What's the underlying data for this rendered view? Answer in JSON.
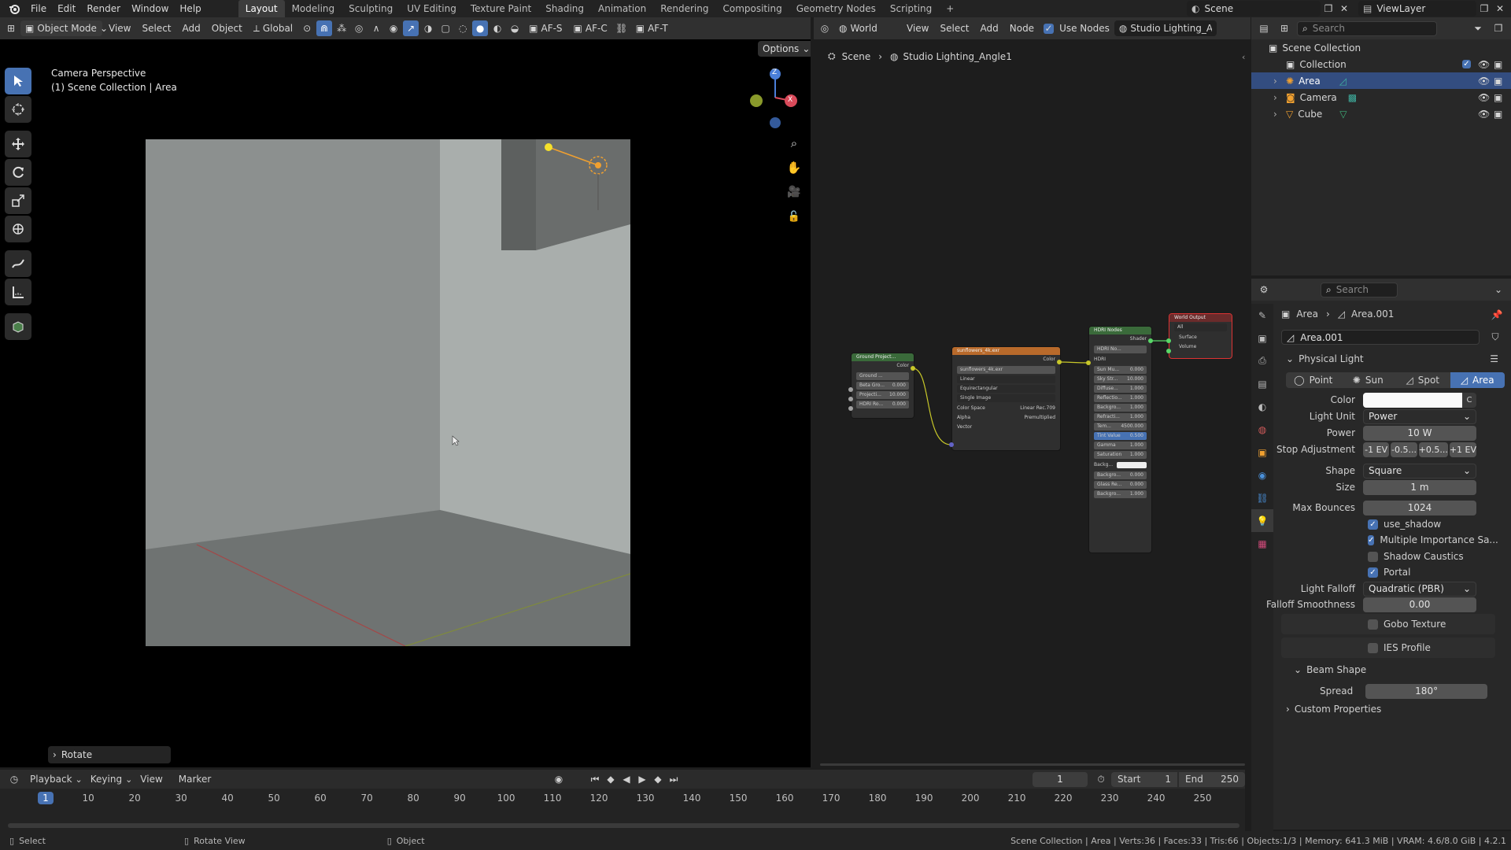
{
  "topbar": {
    "menus": [
      "File",
      "Edit",
      "Render",
      "Window",
      "Help"
    ],
    "workspaces": [
      "Layout",
      "Modeling",
      "Sculpting",
      "UV Editing",
      "Texture Paint",
      "Shading",
      "Animation",
      "Rendering",
      "Compositing",
      "Geometry Nodes",
      "Scripting"
    ],
    "active_workspace": "Layout",
    "scene": "Scene",
    "view_layer": "ViewLayer"
  },
  "viewport_header": {
    "mode": "Object Mode",
    "menus": [
      "View",
      "Select",
      "Add",
      "Object"
    ],
    "orientation": "Global",
    "af_s": "AF-S",
    "af_c": "AF-C",
    "af_t": "AF-T",
    "options": "Options"
  },
  "viewport": {
    "camera_label": "Camera Perspective",
    "collection_label": "(1) Scene Collection | Area",
    "gizmo_x": "X",
    "gizmo_z": "Z",
    "last_op": "Rotate"
  },
  "node_header": {
    "world": "World",
    "menus": [
      "View",
      "Select",
      "Add",
      "Node"
    ],
    "use_nodes": "Use Nodes",
    "world_name": "Studio Lighting_Angle1",
    "breadcrumb_scene": "Scene",
    "breadcrumb_world": "Studio Lighting_Angle1"
  },
  "nodes": {
    "ground": {
      "title": "Ground Project...",
      "color": "Color",
      "field": "Ground ...",
      "rows": [
        [
          "Beta Gro...",
          "0.000"
        ],
        [
          "Projecti...",
          "10.000"
        ],
        [
          "HDRI Ro...",
          "0.000"
        ]
      ]
    },
    "image": {
      "title": "sunflowers_4k.exr",
      "color": "Color",
      "file": "sunflowers_4k.exr",
      "interp": "Linear",
      "proj": "Equirectangular",
      "source": "Single Image",
      "cs_label": "Color Space",
      "cs_value": "Linear Rec.709",
      "alpha_label": "Alpha",
      "alpha_value": "Premultiplied",
      "vector": "Vector"
    },
    "hdri": {
      "title": "HDRI Nodes",
      "shader": "Shader",
      "field": "HDRI No...",
      "hdri": "HDRI",
      "rows": [
        [
          "Sun Mu...",
          "0.000"
        ],
        [
          "Sky Str...",
          "10.000"
        ],
        [
          "Diffuse...",
          "1.000"
        ],
        [
          "Reflectio...",
          "1.000"
        ],
        [
          "Backgro...",
          "1.000"
        ],
        [
          "Refracti...",
          "1.000"
        ],
        [
          "Tem...",
          "4500.000"
        ],
        [
          "Tint Value",
          "0.500"
        ],
        [
          "Gamma",
          "1.000"
        ],
        [
          "Saturation",
          "1.000"
        ]
      ],
      "backg": "Backg...",
      "rows2": [
        [
          "Backgro...",
          "0.000"
        ],
        [
          "Glass Re...",
          "0.000"
        ],
        [
          "Backgro...",
          "1.000"
        ]
      ]
    },
    "output": {
      "title": "World Output",
      "target": "All",
      "surface": "Surface",
      "volume": "Volume"
    }
  },
  "outliner": {
    "search_placeholder": "Search",
    "root": "Scene Collection",
    "collection": "Collection",
    "items": [
      "Area",
      "Camera",
      "Cube"
    ]
  },
  "properties": {
    "search_placeholder": "Search",
    "breadcrumb_obj": "Area",
    "breadcrumb_data": "Area.001",
    "datablock": "Area.001",
    "panel": "Physical Light",
    "light_types": [
      "Point",
      "Sun",
      "Spot",
      "Area"
    ],
    "active_type": "Area",
    "color_label": "Color",
    "light_unit_label": "Light Unit",
    "light_unit": "Power",
    "power_label": "Power",
    "power": "10 W",
    "stop_label": "Stop Adjustment",
    "stops": [
      "-1 EV",
      "-0.5...",
      "+0.5...",
      "+1 EV"
    ],
    "shape_label": "Shape",
    "shape": "Square",
    "size_label": "Size",
    "size": "1 m",
    "bounces_label": "Max Bounces",
    "bounces": "1024",
    "checks": [
      "use_shadow",
      "Multiple Importance Sa...",
      "Shadow Caustics",
      "Portal"
    ],
    "falloff_label": "Light Falloff",
    "falloff": "Quadratic (PBR)",
    "smooth_label": "Falloff Smoothness",
    "smooth": "0.00",
    "gobo": "Gobo Texture",
    "ies": "IES Profile",
    "beam": "Beam Shape",
    "spread_label": "Spread",
    "spread": "180°",
    "custom": "Custom Properties"
  },
  "timeline": {
    "menus": [
      "Playback",
      "Keying",
      "View",
      "Marker"
    ],
    "current": "1",
    "start_label": "Start",
    "start": "1",
    "end_label": "End",
    "end": "250",
    "ticks": [
      "1",
      "10",
      "20",
      "30",
      "40",
      "50",
      "60",
      "70",
      "80",
      "90",
      "100",
      "110",
      "120",
      "130",
      "140",
      "150",
      "160",
      "170",
      "180",
      "190",
      "200",
      "210",
      "220",
      "230",
      "240",
      "250"
    ]
  },
  "statusbar": {
    "select": "Select",
    "rotate": "Rotate View",
    "object": "Object",
    "stats": "Scene Collection | Area | Verts:36 | Faces:33 | Tris:66 | Objects:1/3 | Memory: 641.3 MiB | VRAM: 4.6/8.0 GiB | 4.2.1"
  }
}
